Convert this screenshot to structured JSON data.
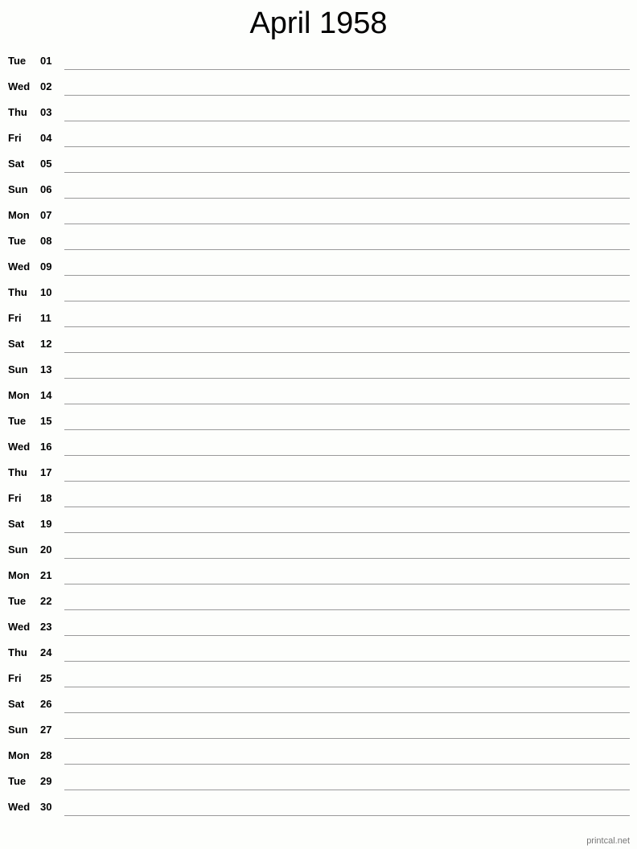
{
  "title": "April 1958",
  "days": [
    {
      "dow": "Tue",
      "day": "01"
    },
    {
      "dow": "Wed",
      "day": "02"
    },
    {
      "dow": "Thu",
      "day": "03"
    },
    {
      "dow": "Fri",
      "day": "04"
    },
    {
      "dow": "Sat",
      "day": "05"
    },
    {
      "dow": "Sun",
      "day": "06"
    },
    {
      "dow": "Mon",
      "day": "07"
    },
    {
      "dow": "Tue",
      "day": "08"
    },
    {
      "dow": "Wed",
      "day": "09"
    },
    {
      "dow": "Thu",
      "day": "10"
    },
    {
      "dow": "Fri",
      "day": "11"
    },
    {
      "dow": "Sat",
      "day": "12"
    },
    {
      "dow": "Sun",
      "day": "13"
    },
    {
      "dow": "Mon",
      "day": "14"
    },
    {
      "dow": "Tue",
      "day": "15"
    },
    {
      "dow": "Wed",
      "day": "16"
    },
    {
      "dow": "Thu",
      "day": "17"
    },
    {
      "dow": "Fri",
      "day": "18"
    },
    {
      "dow": "Sat",
      "day": "19"
    },
    {
      "dow": "Sun",
      "day": "20"
    },
    {
      "dow": "Mon",
      "day": "21"
    },
    {
      "dow": "Tue",
      "day": "22"
    },
    {
      "dow": "Wed",
      "day": "23"
    },
    {
      "dow": "Thu",
      "day": "24"
    },
    {
      "dow": "Fri",
      "day": "25"
    },
    {
      "dow": "Sat",
      "day": "26"
    },
    {
      "dow": "Sun",
      "day": "27"
    },
    {
      "dow": "Mon",
      "day": "28"
    },
    {
      "dow": "Tue",
      "day": "29"
    },
    {
      "dow": "Wed",
      "day": "30"
    }
  ],
  "footer": "printcal.net",
  "colors": {
    "background": "#fdfefc",
    "rule_line": "#9a9a9a",
    "text": "#000000",
    "footer_text": "#777777"
  }
}
